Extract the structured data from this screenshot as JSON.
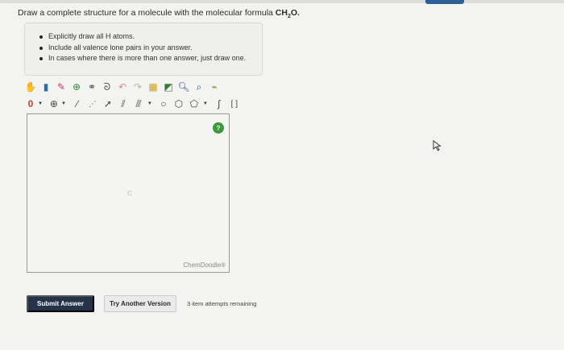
{
  "question": {
    "prefix": "Draw a complete structure for a molecule with the molecular formula ",
    "formula_c": "CH",
    "formula_sub": "2",
    "formula_o": "O."
  },
  "instructions": [
    "Explicitly draw all H atoms.",
    "Include all valence lone pairs in your answer.",
    "In cases where there is more than one answer, just draw one."
  ],
  "toolbar": {
    "row1_icons": [
      "hand-icon",
      "eraser-icon",
      "pencil-icon",
      "ring-plus-icon",
      "group-icon",
      "lasso-icon",
      "undo-icon",
      "redo-icon",
      "template-icon",
      "fill-icon",
      "zoom-in-icon",
      "zoom-out-icon",
      "clean-icon"
    ],
    "row2_charge": "0",
    "row2_atom": "⊕"
  },
  "canvas": {
    "atom_label": "C",
    "help_label": "?",
    "brand": "ChemDoodle®"
  },
  "buttons": {
    "submit": "Submit Answer",
    "try_another": "Try Another Version"
  },
  "attempts_text": "3 item attempts remaining",
  "colors": {
    "submit_bg": "#25334a",
    "help_bg": "#3b9a3b",
    "top_tab": "#2d5f94"
  }
}
